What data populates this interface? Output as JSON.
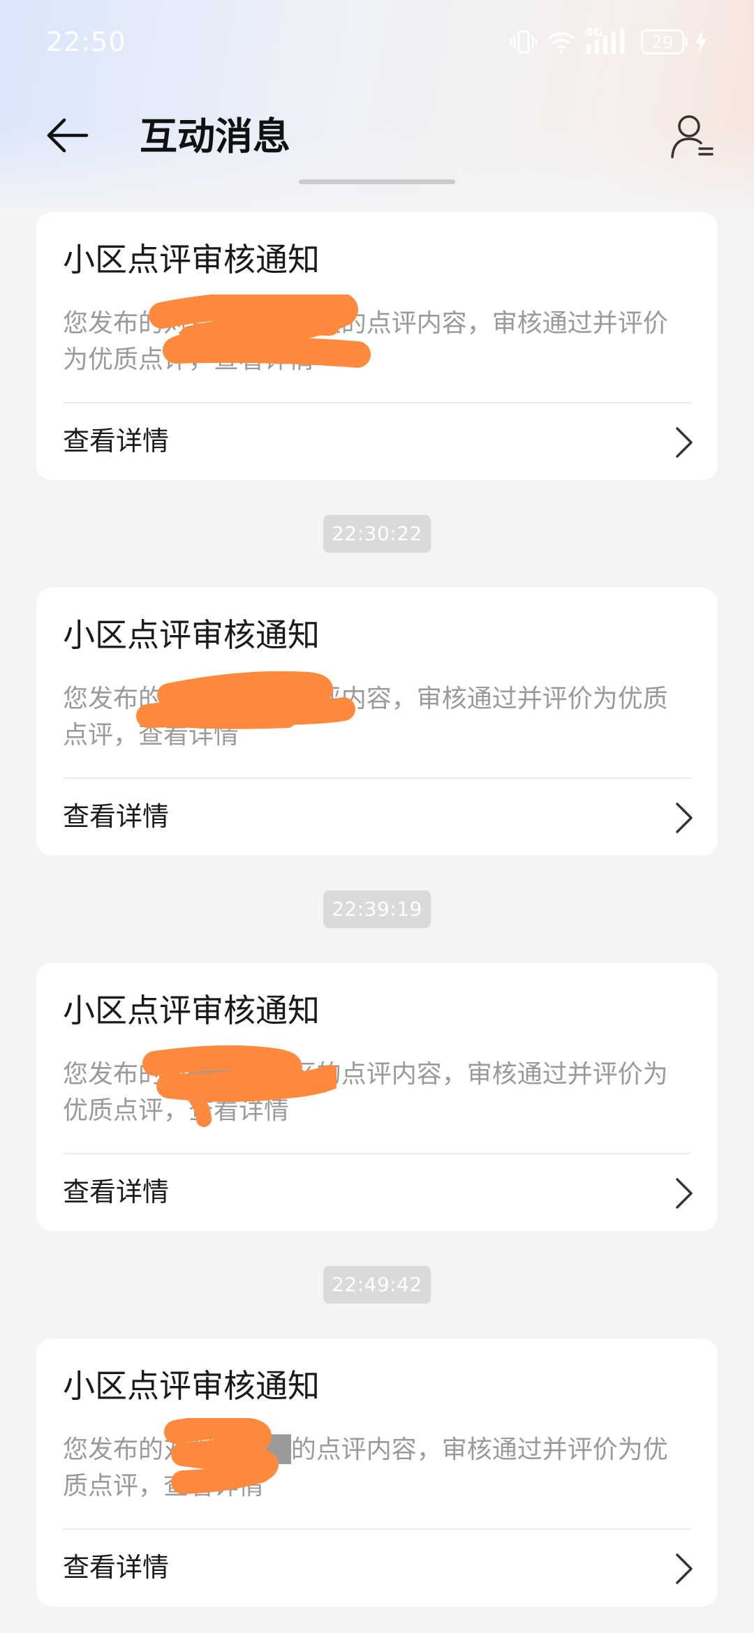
{
  "status_bar": {
    "time": "22:50",
    "network": "4G",
    "battery": "29"
  },
  "header": {
    "title": "互动消息"
  },
  "messages": [
    {
      "title": "小区点评审核通知",
      "body": "您发布的对智████小区的点评内容，审核通过并评价为优质点评，查看详情",
      "detail_label": "查看详情"
    },
    {
      "timestamp": "22:30:22",
      "title": "小区点评审核通知",
      "body": "您发布的对御████点评内容，审核通过并评价为优质点评，查看详情",
      "detail_label": "查看详情"
    },
    {
      "timestamp": "22:39:19",
      "title": "小区点评审核通知",
      "body": "您发布的对████小区的点评内容，审核通过并评价为优质点评，查看详情",
      "detail_label": "查看详情"
    },
    {
      "timestamp": "22:49:42",
      "title": "小区点评审核通知",
      "body": "您发布的对银████的点评内容，审核通过并评价为优质点评，查看详情",
      "detail_label": "查看详情"
    }
  ],
  "colors": {
    "redaction": "#ff8a3d",
    "card_background": "#ffffff",
    "page_background": "#f4f4f6"
  },
  "icons": {
    "back": "arrow-left-icon",
    "profile": "user-settings-icon",
    "detail": "chevron-right-icon"
  }
}
